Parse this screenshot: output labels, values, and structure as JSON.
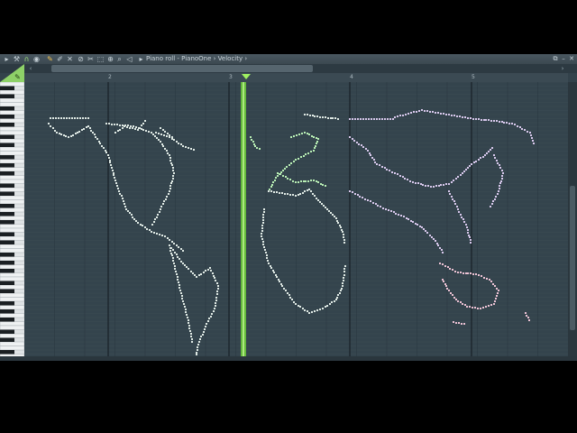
{
  "window": {
    "title_parts": [
      "Piano roll",
      "PianoOne",
      "Velocity"
    ],
    "separator_1": " - ",
    "separator_2": " › ",
    "separator_3": " ›"
  },
  "toolbar": {
    "icons": [
      "menu-arrow-icon",
      "wrench-icon",
      "magnet-icon",
      "stamp-icon",
      "pencil-icon",
      "paint-brush-icon",
      "delete-icon",
      "mute-icon",
      "slice-icon",
      "select-icon",
      "zoom-icon",
      "playback-icon"
    ],
    "window_buttons": [
      "restore",
      "minimize",
      "close"
    ]
  },
  "ruler": {
    "bar_labels": [
      "2",
      "3",
      "4",
      "5"
    ]
  },
  "colors": {
    "note_green": "#b8eeb4",
    "note_white": "#dfe9e4",
    "note_lilac": "#d8c8ec",
    "note_pink": "#ecc2d4",
    "playhead": "#6fcf3a",
    "grid_bg": "#34444d"
  }
}
